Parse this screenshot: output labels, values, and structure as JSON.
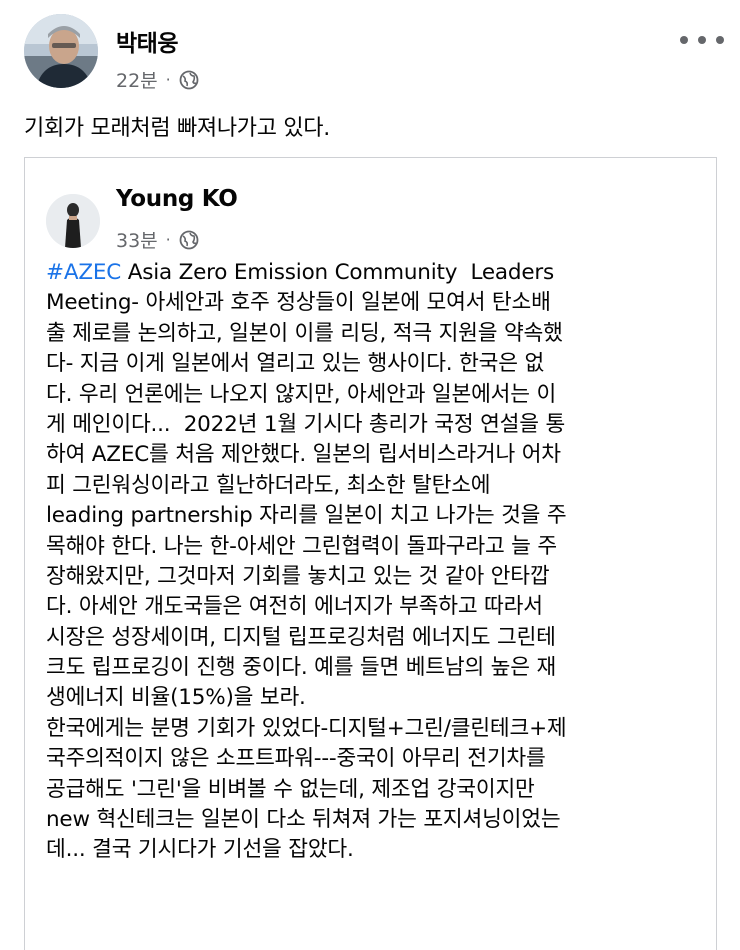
{
  "post": {
    "author": "박태웅",
    "time": "22분",
    "privacy_icon": "globe-icon",
    "more_icon": "more-options-icon",
    "text": "기회가 모래처럼 빠져나가고 있다."
  },
  "shared_post": {
    "author": "Young KO",
    "time": "33분",
    "privacy_icon": "globe-icon",
    "hashtag": "#AZEC",
    "first_line_rest": " Asia Zero Emission Community  Leaders",
    "lines": [
      "Meeting- 아세안과 호주 정상들이 일본에 모여서 탄소배",
      "출 제로를 논의하고, 일본이 이를 리딩, 적극 지원을 약속했",
      "다- 지금 이게 일본에서 열리고 있는 행사이다. 한국은 없",
      "다. 우리 언론에는 나오지 않지만, 아세안과 일본에서는 이",
      "게 메인이다...  2022년 1월 기시다 총리가 국정 연설을 통",
      "하여 AZEC를 처음 제안했다. 일본의 립서비스라거나 어차",
      "피 그린워싱이라고 힐난하더라도, 최소한 탈탄소에",
      "leading partnership 자리를 일본이 치고 나가는 것을 주",
      "목해야 한다. 나는 한-아세안 그린협력이 돌파구라고 늘 주",
      "장해왔지만, 그것마저 기회를 놓치고 있는 것 같아 안타깝",
      "다. 아세안 개도국들은 여전히 에너지가 부족하고 따라서",
      "시장은 성장세이며, 디지털 립프로깅처럼 에너지도 그린테",
      "크도 립프로깅이 진행 중이다. 예를 들면 베트남의 높은 재",
      "생에너지 비율(15%)을 보라.",
      "한국에게는 분명 기회가 있었다-디지털+그린/클린테크+제",
      "국주의적이지 않은 소프트파워---중국이 아무리 전기차를",
      "공급해도 '그린'을 비벼볼 수 없는데, 제조업 강국이지만",
      "new 혁신테크는 일본이 다소 뒤쳐져 가는 포지셔닝이었는",
      "데... 결국 기시다가 기선을 잡았다."
    ]
  },
  "colors": {
    "hashtag": "#1a73e8",
    "meta_text": "#65676b",
    "border": "#ced0d4"
  }
}
